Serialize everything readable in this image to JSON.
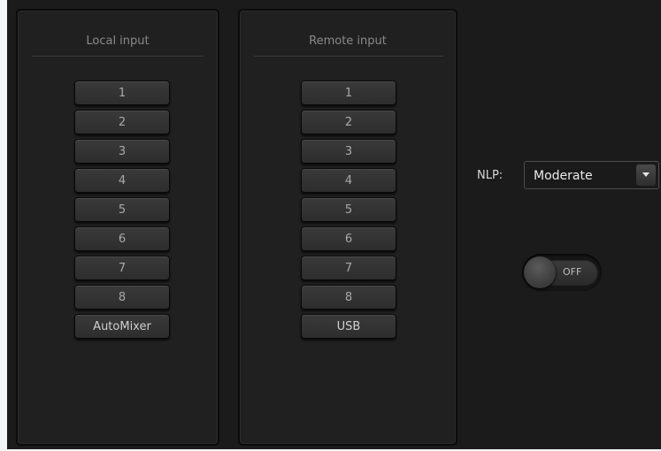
{
  "local": {
    "title": "Local input",
    "buttons": [
      "1",
      "2",
      "3",
      "4",
      "5",
      "6",
      "7",
      "8",
      "AutoMixer"
    ]
  },
  "remote": {
    "title": "Remote input",
    "buttons": [
      "1",
      "2",
      "3",
      "4",
      "5",
      "6",
      "7",
      "8",
      "USB"
    ]
  },
  "nlp": {
    "label": "NLP:",
    "selected": "Moderate"
  },
  "toggle": {
    "state_label": "OFF"
  },
  "colors": {
    "background": "#1b1b1b",
    "panel": "#202020",
    "button": "#333333",
    "text": "#a9a9a9"
  }
}
